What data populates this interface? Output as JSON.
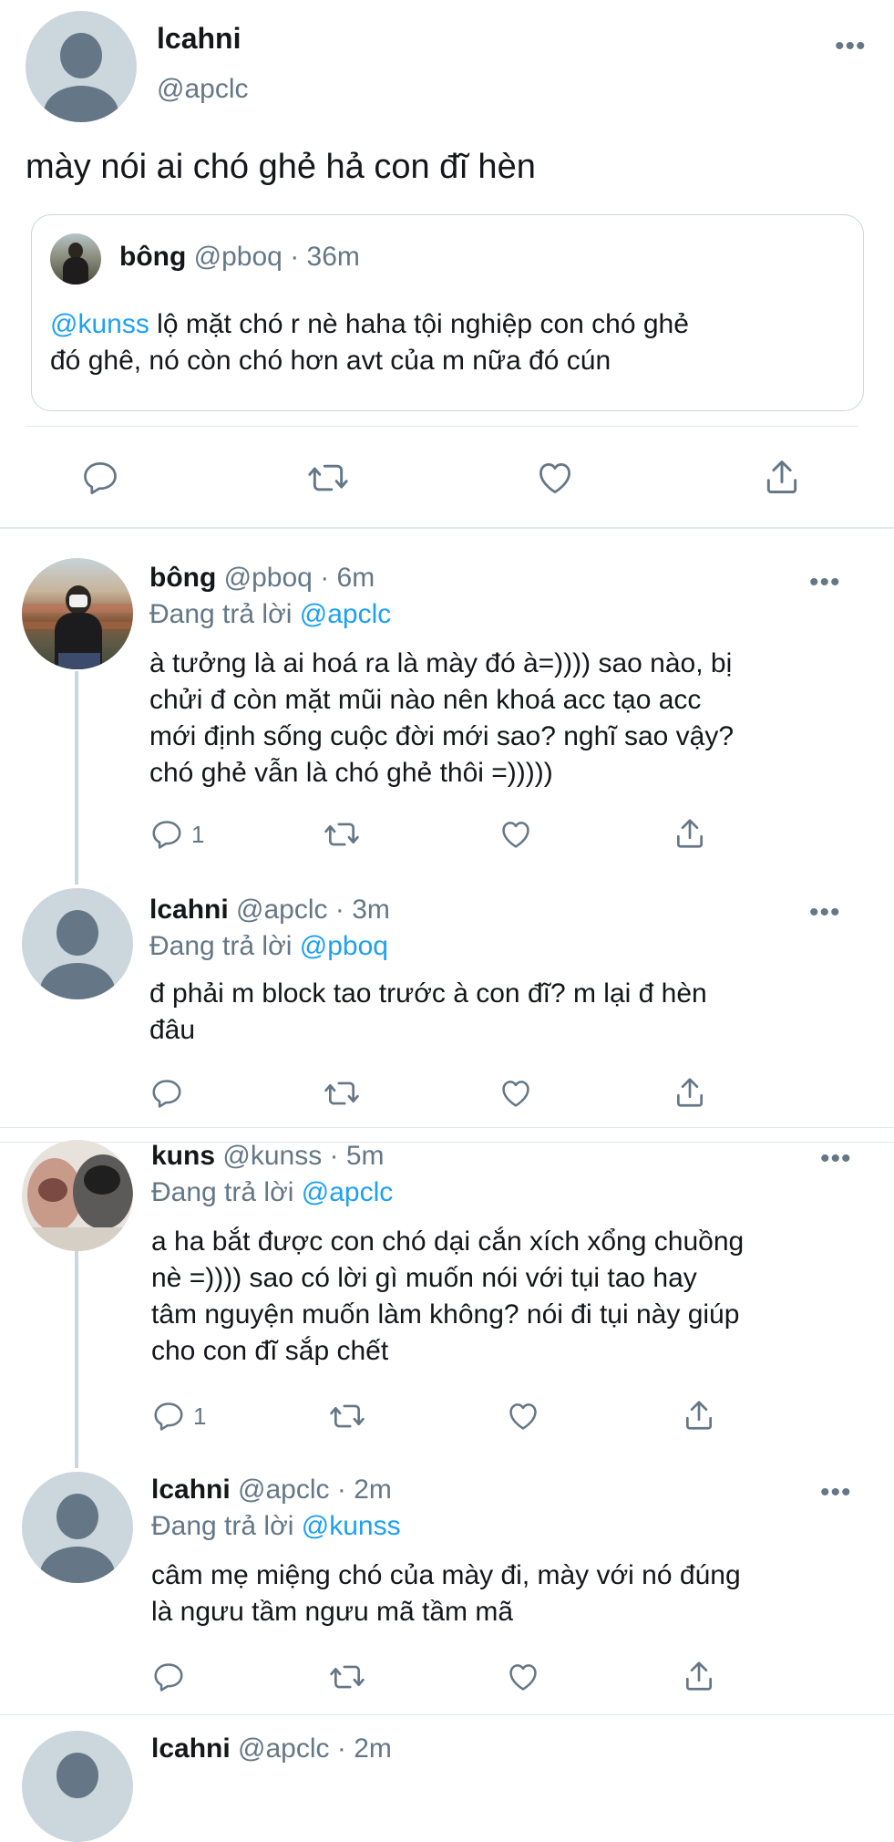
{
  "main_tweet": {
    "display_name": "lcahni",
    "handle": "@apclc",
    "text": "mày nói ai chó ghẻ hả con đĩ hèn",
    "more_icon": "more-icon",
    "quote": {
      "display_name": "bông",
      "handle": "@pboq",
      "time": "· 36m",
      "mention": "@kunss",
      "text_line1": " lộ mặt chó r nè haha tội nghiệp con chó ghẻ",
      "text_line2": "đó ghê, nó còn chó hơn avt của m nữa đó cún"
    }
  },
  "replies": [
    {
      "display_name": "bông",
      "handle": "@pboq",
      "time": "· 6m",
      "replying_prefix": "Đang trả lời ",
      "replying_to": "@apclc",
      "lines": [
        "à tưởng là ai hoá ra là mày đó à=)))) sao nào, bị",
        "chửi đ còn mặt mũi nào nên khoá acc tạo acc",
        "mới định sống cuộc đời mới sao? nghĩ sao vậy?",
        "chó ghẻ vẫn là chó ghẻ thôi =)))))"
      ],
      "reply_count": "1"
    },
    {
      "display_name": "lcahni",
      "handle": "@apclc",
      "time": "· 3m",
      "replying_prefix": "Đang trả lời ",
      "replying_to": "@pboq",
      "lines": [
        "đ phải m block tao trước à con đĩ? m lại đ hèn",
        "đâu"
      ],
      "reply_count": ""
    },
    {
      "display_name": "kuns",
      "handle": "@kunss",
      "time": "· 5m",
      "replying_prefix": "Đang trả lời ",
      "replying_to": "@apclc",
      "lines": [
        "a ha bắt được con chó dại cắn xích xổng chuồng",
        "nè =)))) sao có lời gì muốn nói với tụi tao hay",
        "tâm nguyện muốn làm không? nói đi tụi này giúp",
        "cho con đĩ sắp chết"
      ],
      "reply_count": "1"
    },
    {
      "display_name": "lcahni",
      "handle": "@apclc",
      "time": "· 2m",
      "replying_prefix": "Đang trả lời ",
      "replying_to": "@kunss",
      "lines": [
        "câm mẹ miệng chó của mày đi, mày với nó đúng",
        "là ngưu tầm ngưu mã tầm mã"
      ],
      "reply_count": ""
    }
  ],
  "partial_next": {
    "display_name": "lcahni",
    "handle": "@apclc",
    "time": "· 2m"
  },
  "colors": {
    "accent": "#1da1f2",
    "secondary_text": "#657786",
    "divider": "#e1e8ed"
  }
}
